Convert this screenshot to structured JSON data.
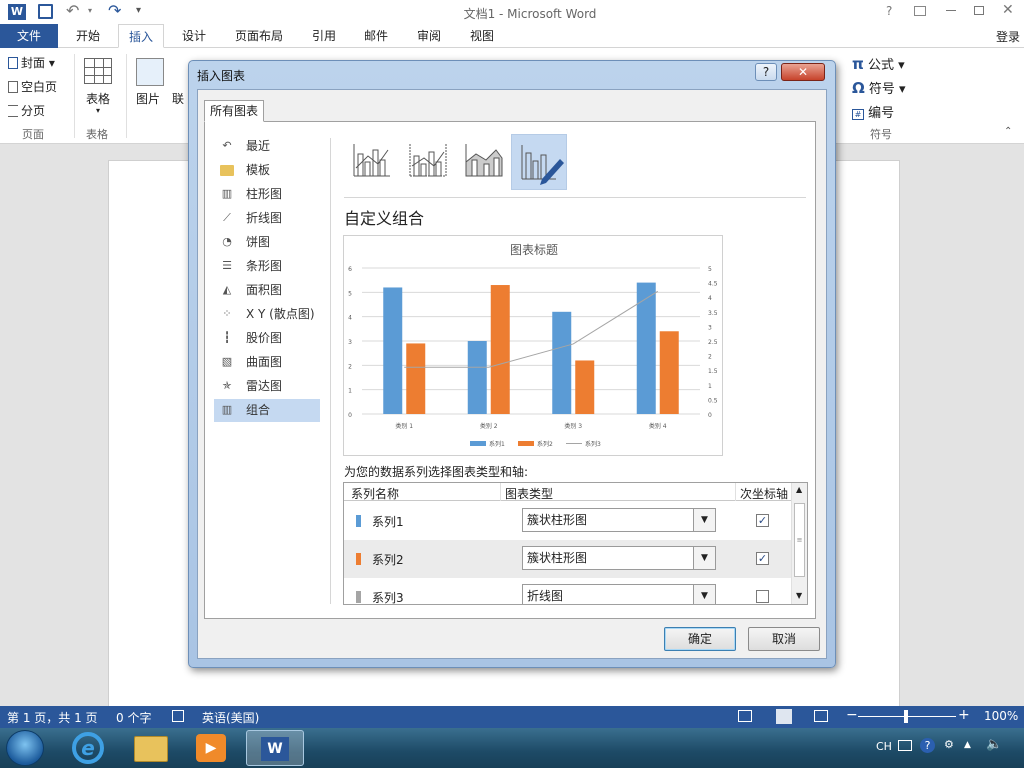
{
  "window": {
    "title": "文档1 - Microsoft Word",
    "signin": "登录"
  },
  "ribbon_tabs": [
    "文件",
    "开始",
    "插入",
    "设计",
    "页面布局",
    "引用",
    "邮件",
    "审阅",
    "视图"
  ],
  "ribbon": {
    "pages_group": {
      "cover": "封面",
      "blank": "空白页",
      "break": "分页",
      "label": "页面"
    },
    "table_group": {
      "table": "表格",
      "label": "表格"
    },
    "illustrations": {
      "picture": "图片",
      "online": "联"
    },
    "symbols_group": {
      "equation": "公式",
      "symbol": "符号",
      "number": "编号",
      "label": "符号"
    }
  },
  "dialog": {
    "title": "插入图表",
    "tab": "所有图表",
    "nav": [
      "最近",
      "模板",
      "柱形图",
      "折线图",
      "饼图",
      "条形图",
      "面积图",
      "X Y (散点图)",
      "股价图",
      "曲面图",
      "雷达图",
      "组合"
    ],
    "selected_nav": "组合",
    "combo_title": "自定义组合",
    "series_prompt": "为您的数据系列选择图表类型和轴:",
    "table_headers": {
      "name": "系列名称",
      "type": "图表类型",
      "axis": "次坐标轴"
    },
    "rows": [
      {
        "name": "系列1",
        "type": "簇状柱形图",
        "secondary": true,
        "color": "#5b9bd5"
      },
      {
        "name": "系列2",
        "type": "簇状柱形图",
        "secondary": true,
        "color": "#ed7d31"
      },
      {
        "name": "系列3",
        "type": "折线图",
        "secondary": false,
        "color": "#a5a5a5"
      }
    ],
    "ok": "确定",
    "cancel": "取消"
  },
  "chart_data": {
    "type": "bar",
    "title": "图表标题",
    "categories": [
      "类别 1",
      "类别 2",
      "类别 3",
      "类别 4"
    ],
    "series": [
      {
        "name": "系列1",
        "type": "bar",
        "color": "#5b9bd5",
        "values": [
          5.2,
          3.0,
          4.2,
          5.4
        ]
      },
      {
        "name": "系列2",
        "type": "bar",
        "color": "#ed7d31",
        "values": [
          2.9,
          5.3,
          2.2,
          3.4
        ]
      },
      {
        "name": "系列3",
        "type": "line",
        "color": "#a5a5a5",
        "values": [
          1.6,
          1.6,
          2.4,
          4.2
        ]
      }
    ],
    "ylim": [
      0,
      6
    ],
    "y2lim": [
      0,
      5
    ],
    "yticks": [
      0,
      1,
      2,
      3,
      4,
      5,
      6
    ],
    "y2ticks": [
      0,
      0.5,
      1,
      1.5,
      2,
      2.5,
      3,
      3.5,
      4,
      4.5,
      5
    ],
    "legend": "bottom",
    "grid": true
  },
  "status": {
    "page": "第 1 页，共 1 页",
    "words": "0 个字",
    "lang": "英语(美国)",
    "zoom": "100%"
  },
  "tray": {
    "lang": "CH"
  }
}
